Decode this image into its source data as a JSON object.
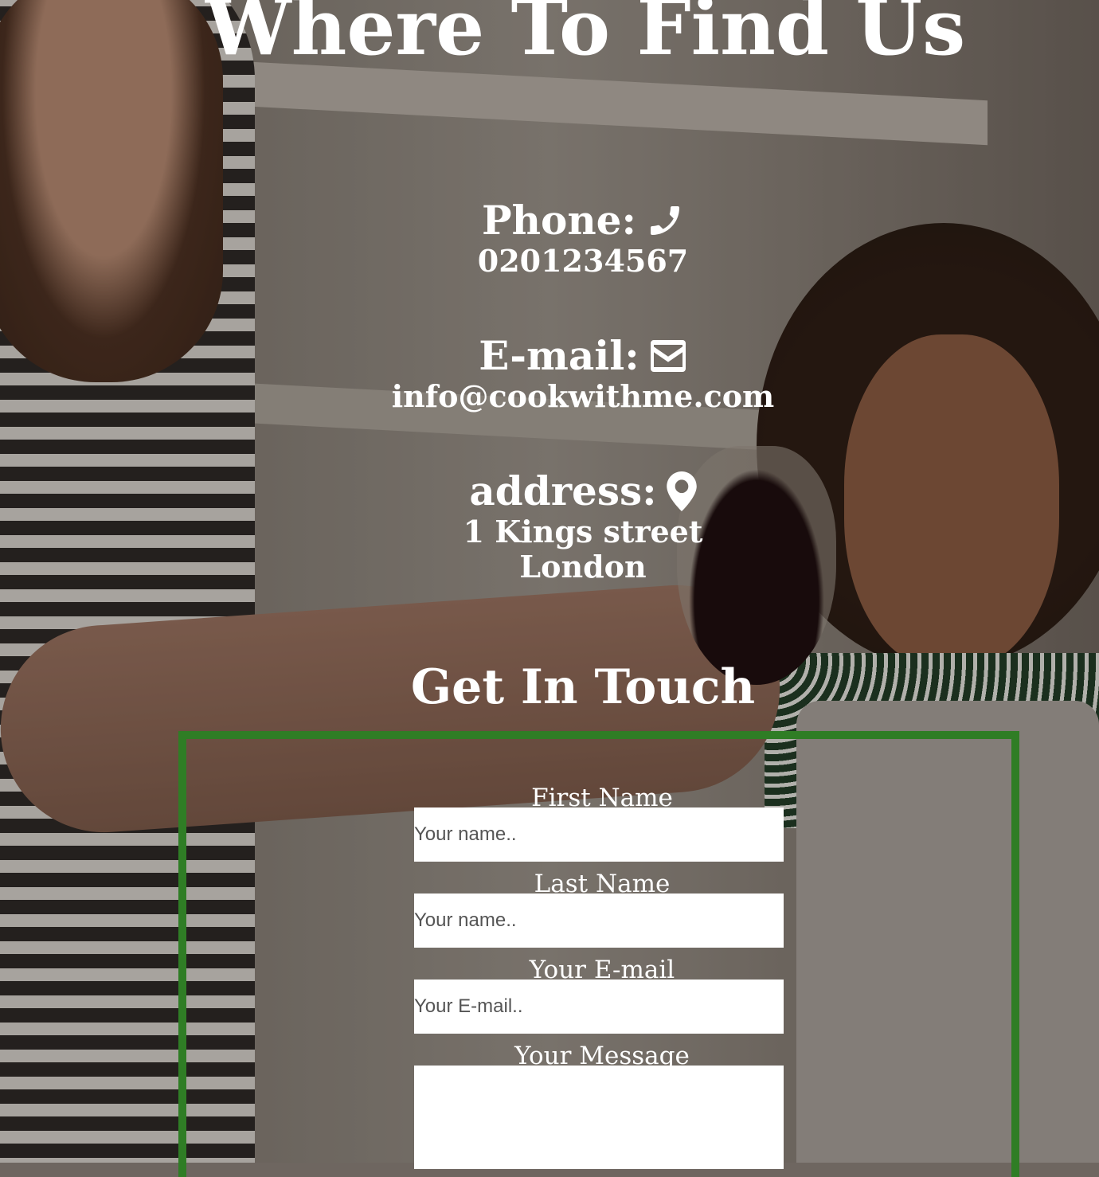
{
  "page": {
    "title": "Where To Find Us"
  },
  "contact": {
    "phone_label": "Phone:",
    "phone_icon": "phone-icon",
    "phone_value": "0201234567",
    "email_label": "E-mail:",
    "email_icon": "envelope-icon",
    "email_value": "info@cookwithme.com",
    "address_label": "address:",
    "address_icon": "map-marker-icon",
    "address_line1": "1 Kings street",
    "address_line2": "London"
  },
  "form": {
    "heading": "Get In Touch",
    "border_color": "#2f7d25",
    "first_name_label": "First Name",
    "first_name_placeholder": "Your name..",
    "last_name_label": "Last Name",
    "last_name_placeholder": "Your name..",
    "email_label": "Your E-mail",
    "email_placeholder": "Your E-mail..",
    "message_label": "Your Message",
    "message_placeholder": ""
  }
}
